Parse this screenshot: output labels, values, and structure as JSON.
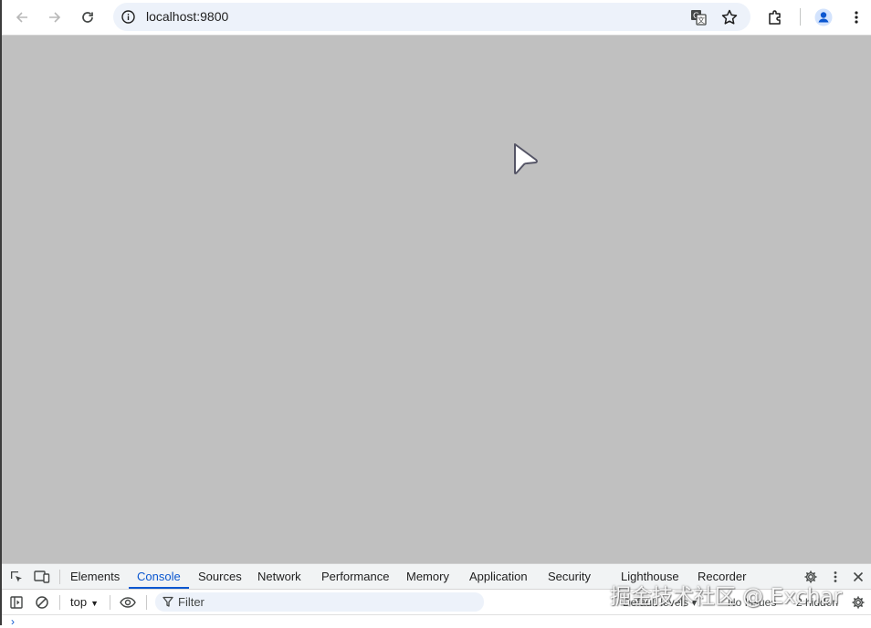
{
  "browser": {
    "url": "localhost:9800",
    "icons": [
      "back-icon",
      "forward-icon",
      "reload-icon",
      "site-info-icon",
      "translate-icon",
      "bookmark-star-icon",
      "extensions-icon",
      "profile-icon",
      "menu-icon"
    ]
  },
  "page": {
    "background": "#c0c0c0"
  },
  "devtools": {
    "tabs": [
      "Elements",
      "Console",
      "Sources",
      "Network",
      "Performance",
      "Memory",
      "Application",
      "Security",
      "Lighthouse",
      "Recorder"
    ],
    "active_tab": "Console",
    "context": "top",
    "filter_placeholder": "Filter",
    "levels_label": "Default levels",
    "issues_label": "No Issues",
    "hidden_label": "2 hidden",
    "accent": "#0b57d0"
  },
  "watermark": "掘金技术社区 @ Exchar"
}
